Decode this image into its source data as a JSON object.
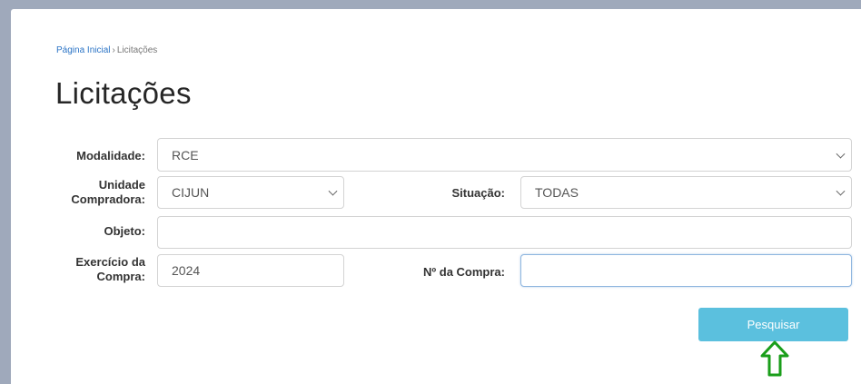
{
  "breadcrumb": {
    "home": "Página Inicial",
    "separator": "›",
    "current": "Licitações"
  },
  "page_title": "Licitações",
  "form": {
    "modalidade": {
      "label": "Modalidade:",
      "value": "RCE"
    },
    "unidade": {
      "label_line1": "Unidade",
      "label_line2": "Compradora:",
      "value": "CIJUN"
    },
    "situacao": {
      "label": "Situação:",
      "value": "TODAS"
    },
    "objeto": {
      "label": "Objeto:",
      "value": ""
    },
    "exercicio": {
      "label_line1": "Exercício da",
      "label_line2": "Compra:",
      "value": "2024"
    },
    "numero": {
      "label": "Nº da Compra:",
      "value": ""
    }
  },
  "search_button": "Pesquisar",
  "colors": {
    "button": "#5bc0de",
    "arrow": "#1a9e1a",
    "link": "#2b74c6"
  },
  "icons": {
    "dropdown": "chevron-down-icon",
    "pointer": "arrow-up-icon"
  }
}
